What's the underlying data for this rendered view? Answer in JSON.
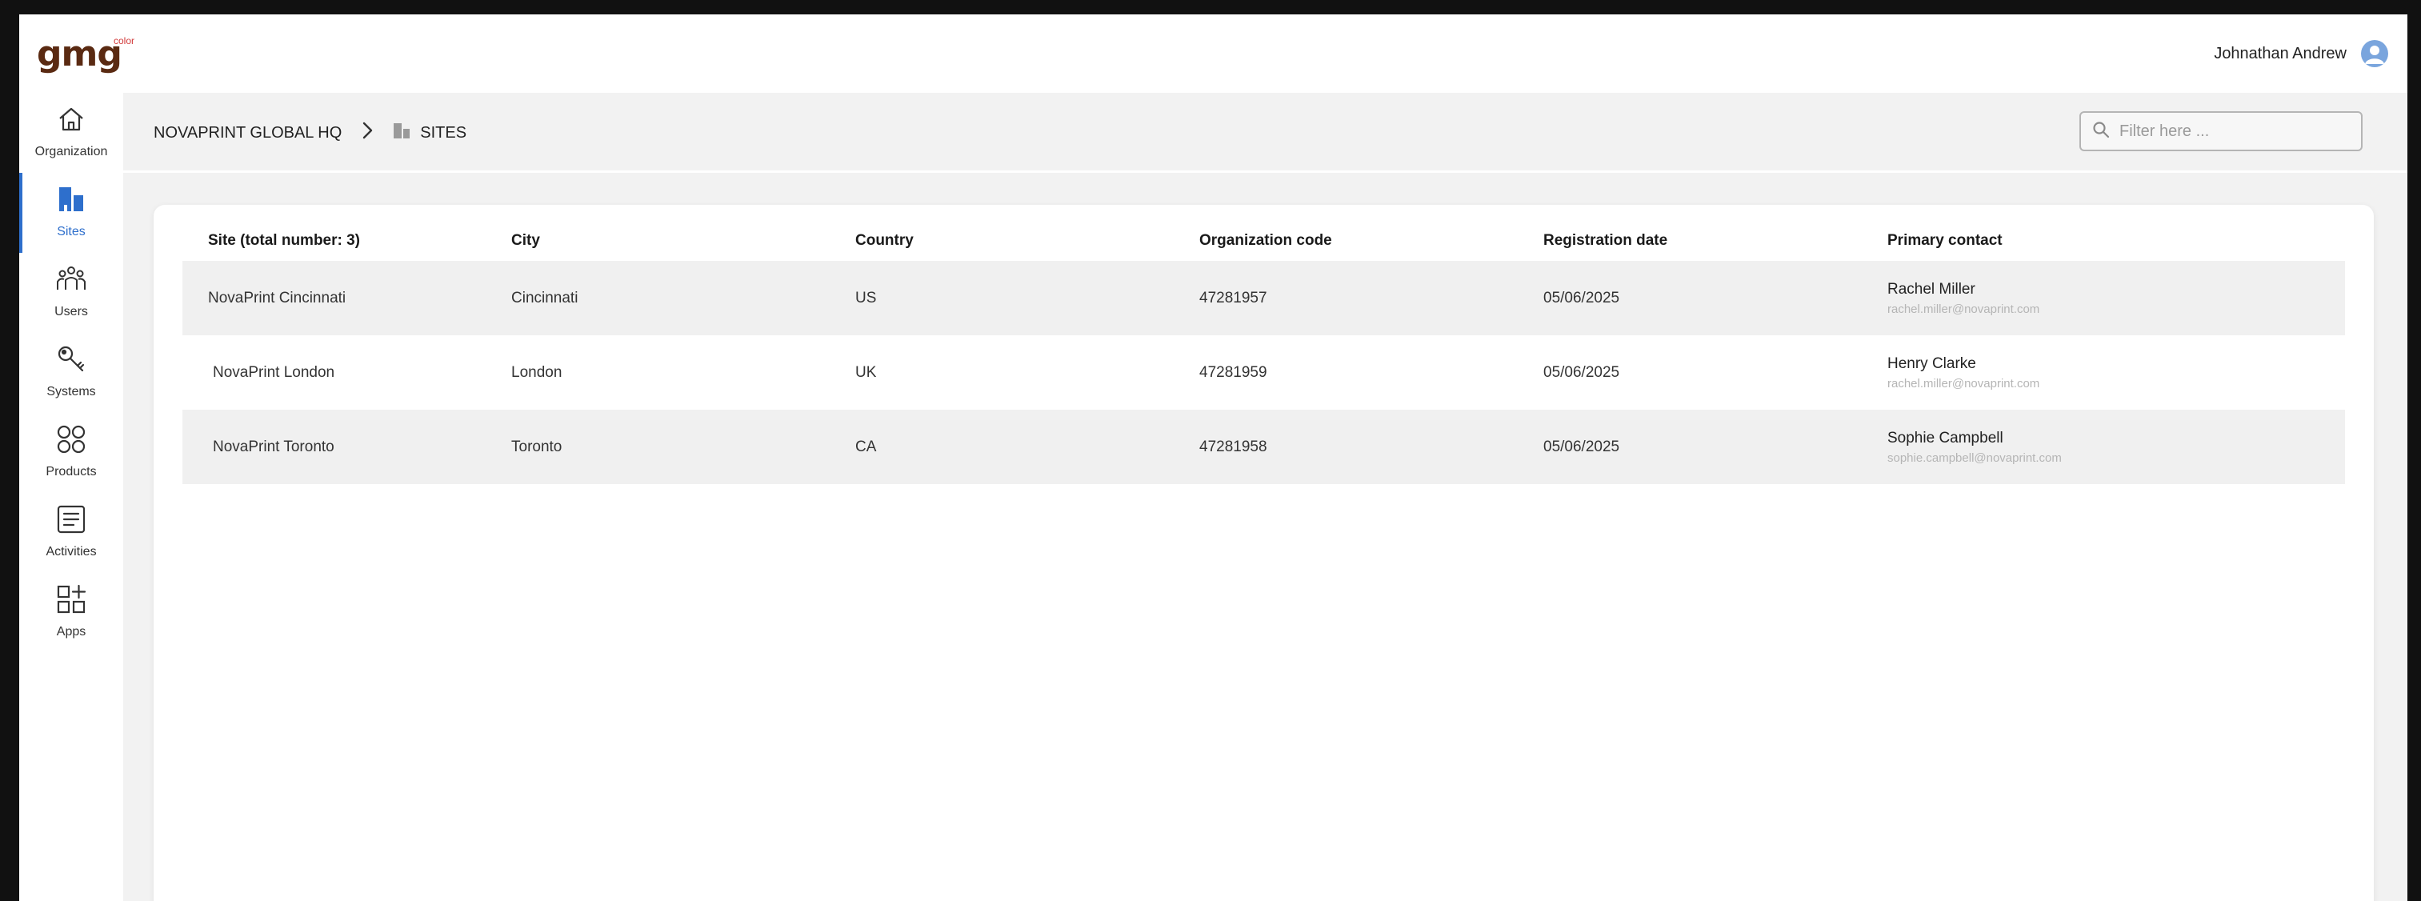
{
  "app": {
    "logo_text": "gmg",
    "logo_sup": "color"
  },
  "user": {
    "name": "Johnathan Andrew"
  },
  "sidebar": {
    "items": [
      {
        "label": "Organization",
        "icon": "home-icon"
      },
      {
        "label": "Sites",
        "icon": "sites-icon",
        "active": true
      },
      {
        "label": "Users",
        "icon": "users-icon"
      },
      {
        "label": "Systems",
        "icon": "key-icon"
      },
      {
        "label": "Products",
        "icon": "products-icon"
      },
      {
        "label": "Activities",
        "icon": "activities-icon"
      },
      {
        "label": "Apps",
        "icon": "apps-icon"
      }
    ]
  },
  "breadcrumb": {
    "parent": "NOVAPRINT GLOBAL HQ",
    "current": "SITES"
  },
  "filter": {
    "placeholder": "Filter here ..."
  },
  "table": {
    "headers": [
      "Site (total number: 3)",
      "City",
      "Country",
      "Organization code",
      "Registration date",
      "Primary contact"
    ],
    "rows": [
      {
        "site": "NovaPrint Cincinnati",
        "city": "Cincinnati",
        "country": "US",
        "code": "47281957",
        "date": "05/06/2025",
        "contact_name": "Rachel Miller",
        "contact_email": "rachel.miller@novaprint.com"
      },
      {
        "site": "NovaPrint London",
        "city": "London",
        "country": "UK",
        "code": "47281959",
        "date": "05/06/2025",
        "contact_name": "Henry Clarke",
        "contact_email": "rachel.miller@novaprint.com"
      },
      {
        "site": "NovaPrint Toronto",
        "city": "Toronto",
        "country": "CA",
        "code": "47281958",
        "date": "05/06/2025",
        "contact_name": "Sophie Campbell",
        "contact_email": "sophie.campbell@novaprint.com"
      }
    ]
  },
  "colors": {
    "accent": "#2e6fcc",
    "logo": "#5a2a12",
    "row_shade": "#f0f0f0"
  }
}
